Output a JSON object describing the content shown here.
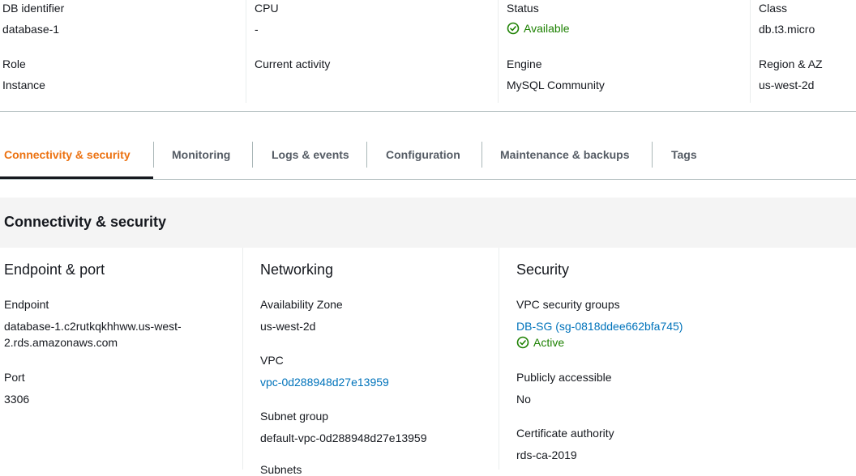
{
  "summary": {
    "db_identifier": {
      "label": "DB identifier",
      "value": "database-1"
    },
    "role": {
      "label": "Role",
      "value": "Instance"
    },
    "cpu": {
      "label": "CPU",
      "value": "-"
    },
    "current_activity": {
      "label": "Current activity",
      "value": ""
    },
    "status": {
      "label": "Status",
      "value": "Available",
      "icon": "check-circle-icon",
      "color": "#1d8102"
    },
    "engine": {
      "label": "Engine",
      "value": "MySQL Community"
    },
    "class": {
      "label": "Class",
      "value": "db.t3.micro"
    },
    "region_az": {
      "label": "Region & AZ",
      "value": "us-west-2d"
    }
  },
  "tabs": [
    {
      "label": "Connectivity & security",
      "active": true
    },
    {
      "label": "Monitoring",
      "active": false
    },
    {
      "label": "Logs & events",
      "active": false
    },
    {
      "label": "Configuration",
      "active": false
    },
    {
      "label": "Maintenance & backups",
      "active": false
    },
    {
      "label": "Tags",
      "active": false
    }
  ],
  "panel": {
    "title": "Connectivity & security",
    "endpoint_port": {
      "title": "Endpoint & port",
      "endpoint_label": "Endpoint",
      "endpoint_value_line1": "database-1.c2rutkqkhhww.us-west-",
      "endpoint_value_line2": "2.rds.amazonaws.com",
      "port_label": "Port",
      "port_value": "3306"
    },
    "networking": {
      "title": "Networking",
      "az_label": "Availability Zone",
      "az_value": "us-west-2d",
      "vpc_label": "VPC",
      "vpc_value": "vpc-0d288948d27e13959",
      "subnet_group_label": "Subnet group",
      "subnet_group_value": "default-vpc-0d288948d27e13959",
      "subnets_label": "Subnets"
    },
    "security": {
      "title": "Security",
      "vpc_sg_label": "VPC security groups",
      "vpc_sg_value": "DB-SG (sg-0818ddee662bfa745)",
      "vpc_sg_status": "Active",
      "public_label": "Publicly accessible",
      "public_value": "No",
      "ca_label": "Certificate authority",
      "ca_value": "rds-ca-2019"
    }
  },
  "colors": {
    "accent_orange": "#ec7211",
    "link_blue": "#0073bb",
    "success_green": "#1d8102"
  }
}
